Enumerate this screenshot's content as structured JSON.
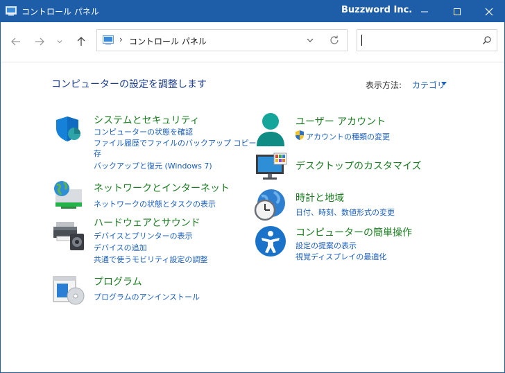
{
  "window": {
    "title": "コントロール パネル",
    "brand": "Buzzword Inc.",
    "minimize_glyph": "—",
    "maximize_glyph": "☐",
    "close_glyph": "✕"
  },
  "navigation": {
    "back": "←",
    "forward": "→",
    "recent": "⌄",
    "up": "↑",
    "address_separator_1": "›",
    "address_crumb": "コントロール パネル",
    "address_separator_2": "›",
    "search_value": "",
    "search_placeholder": ""
  },
  "main": {
    "heading": "コンピューターの設定を調整します",
    "view_by_label": "表示方法:",
    "view_by_value": "カテゴリ"
  },
  "categories": {
    "system": {
      "title": "システムとセキュリティ",
      "links": [
        "コンピューターの状態を確認",
        "ファイル履歴でファイルのバックアップ コピーを保",
        "存",
        "バックアップと復元 (Windows 7)"
      ]
    },
    "network": {
      "title": "ネットワークとインターネット",
      "links": [
        "ネットワークの状態とタスクの表示"
      ]
    },
    "hardware": {
      "title": "ハードウェアとサウンド",
      "links": [
        "デバイスとプリンターの表示",
        "デバイスの追加",
        "共通で使うモビリティ設定の調整"
      ]
    },
    "programs": {
      "title": "プログラム",
      "links": [
        "プログラムのアンインストール"
      ]
    },
    "user": {
      "title": "ユーザー アカウント",
      "links": [
        "アカウントの種類の変更"
      ]
    },
    "desktop": {
      "title": "デスクトップのカスタマイズ",
      "links": []
    },
    "clock": {
      "title": "時計と地域",
      "links": [
        "日付、時刻、数値形式の変更"
      ]
    },
    "ease": {
      "title": "コンピューターの簡単操作",
      "links": [
        "設定の提案の表示",
        "視覚ディスプレイの最適化"
      ]
    }
  },
  "colors": {
    "titlebar": "#1e5ea9",
    "category_title": "#1a7d1f",
    "link": "#1b5fbd",
    "heading": "#1c3f8f"
  }
}
